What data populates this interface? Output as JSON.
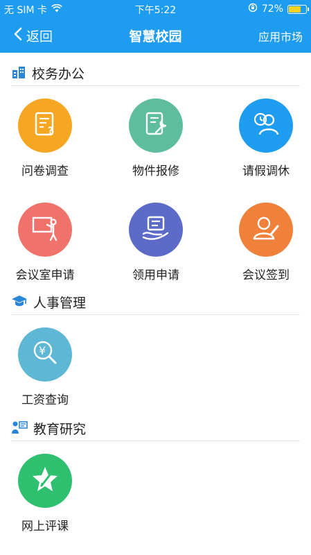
{
  "status_bar": {
    "carrier": "无 SIM 卡",
    "time": "下午5:22",
    "battery_percent": "72%",
    "battery_level": 0.72
  },
  "nav": {
    "back_label": "返回",
    "title": "智慧校园",
    "market_label": "应用市场"
  },
  "colors": {
    "primary": "#1e9cf0"
  },
  "sections": [
    {
      "title": "校务办公",
      "icon": "building-icon",
      "items": [
        {
          "label": "问卷调查",
          "icon": "questionnaire-icon",
          "color": "#f5a623"
        },
        {
          "label": "物件报修",
          "icon": "wrench-icon",
          "color": "#5dbd9d"
        },
        {
          "label": "请假调休",
          "icon": "user-clock-icon",
          "color": "#1e9cf0"
        },
        {
          "label": "会议室申请",
          "icon": "presentation-icon",
          "color": "#f0736b"
        },
        {
          "label": "领用申请",
          "icon": "hand-document-icon",
          "color": "#5c6bc7"
        },
        {
          "label": "会议签到",
          "icon": "user-sign-icon",
          "color": "#f0813a"
        }
      ]
    },
    {
      "title": "人事管理",
      "icon": "graduation-cap-icon",
      "items": [
        {
          "label": "工资查询",
          "icon": "salary-search-icon",
          "color": "#5eb7d4"
        }
      ]
    },
    {
      "title": "教育研究",
      "icon": "teacher-board-icon",
      "items": [
        {
          "label": "网上评课",
          "icon": "star-pen-icon",
          "color": "#2ebf6f"
        }
      ]
    }
  ]
}
